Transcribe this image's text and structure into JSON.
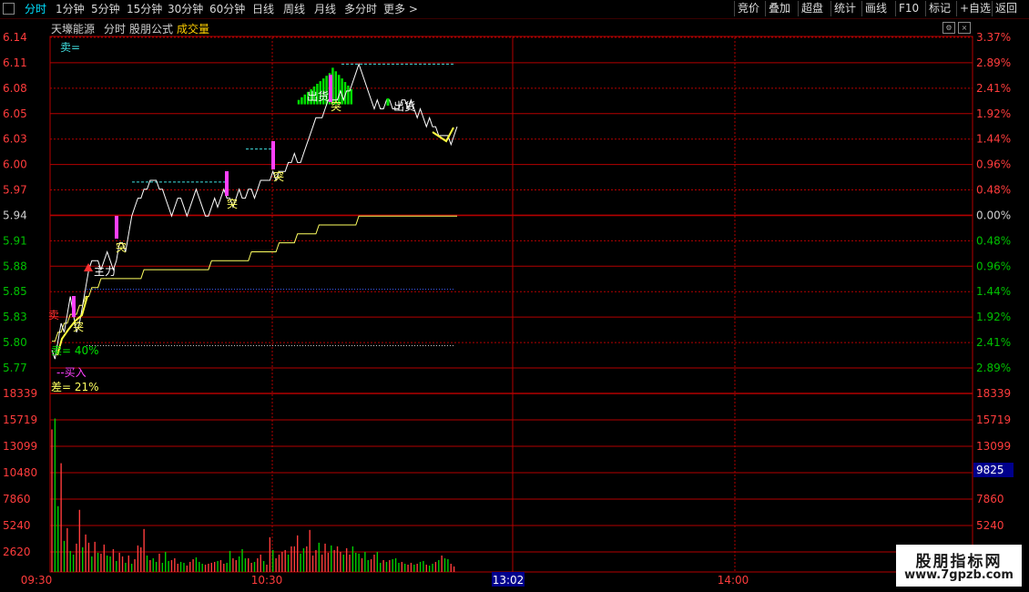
{
  "toolbar": {
    "tabs": [
      "分时",
      "1分钟",
      "5分钟",
      "15分钟",
      "30分钟",
      "60分钟",
      "日线",
      "周线",
      "月线",
      "多分时",
      "更多 >"
    ],
    "active_tab": "分时",
    "right_buttons": [
      "竞价",
      "叠加",
      "超盘",
      "统计",
      "画线",
      "F10",
      "标记",
      "+自选",
      "返回"
    ]
  },
  "header": {
    "stock_name": "天壕能源",
    "mode": "分时",
    "formula": "股朋公式",
    "volume_label": "成交量"
  },
  "chart_data": {
    "type": "line",
    "price_axis": {
      "labels": [
        "6.14",
        "6.11",
        "6.08",
        "6.05",
        "6.03",
        "6.00",
        "5.97",
        "5.94",
        "5.91",
        "5.88",
        "5.85",
        "5.83",
        "5.80",
        "5.77"
      ],
      "min": 5.77,
      "max": 6.14,
      "prev_close": 5.94,
      "pct_labels": [
        "3.37%",
        "2.89%",
        "2.41%",
        "1.92%",
        "1.44%",
        "0.96%",
        "0.48%",
        "0.00%",
        "0.48%",
        "0.96%",
        "1.44%",
        "1.92%",
        "2.41%",
        "2.89%"
      ]
    },
    "volume_axis": {
      "labels": [
        "18339",
        "15719",
        "13099",
        "10480",
        "7860",
        "5240",
        "2620"
      ],
      "max": 18339,
      "current_volume": "9825"
    },
    "time_axis": [
      "09:30",
      "10:30",
      "13:02",
      "14:00"
    ],
    "price_series": [
      5.79,
      5.78,
      5.8,
      5.82,
      5.81,
      5.83,
      5.85,
      5.83,
      5.81,
      5.82,
      5.84,
      5.86,
      5.88,
      5.89,
      5.89,
      5.89,
      5.88,
      5.89,
      5.9,
      5.89,
      5.88,
      5.89,
      5.91,
      5.91,
      5.9,
      5.92,
      5.94,
      5.95,
      5.96,
      5.96,
      5.97,
      5.97,
      5.98,
      5.98,
      5.98,
      5.97,
      5.97,
      5.96,
      5.95,
      5.94,
      5.95,
      5.96,
      5.96,
      5.95,
      5.94,
      5.95,
      5.96,
      5.97,
      5.96,
      5.95,
      5.94,
      5.94,
      5.95,
      5.96,
      5.95,
      5.96,
      5.97,
      5.96,
      5.96,
      5.95,
      5.96,
      5.97,
      5.96,
      5.96,
      5.97,
      5.97,
      5.96,
      5.97,
      5.98,
      5.98,
      5.98,
      5.98,
      5.99,
      5.98,
      5.99,
      5.99,
      5.99,
      6.0,
      6.0,
      6.01,
      6.0,
      6.0,
      6.01,
      6.02,
      6.03,
      6.04,
      6.05,
      6.05,
      6.05,
      6.06,
      6.07,
      6.07,
      6.07,
      6.07,
      6.08,
      6.07,
      6.08,
      6.08,
      6.09,
      6.1,
      6.11,
      6.1,
      6.09,
      6.08,
      6.07,
      6.06,
      6.07,
      6.06,
      6.06,
      6.07,
      6.07,
      6.06,
      6.06,
      6.06,
      6.07,
      6.07,
      6.06,
      6.07,
      6.06,
      6.05,
      6.06,
      6.05,
      6.04,
      6.05,
      6.04,
      6.04,
      6.03,
      6.03,
      6.03,
      6.03,
      6.02,
      6.03,
      6.04
    ],
    "avg_series": [
      5.8,
      5.8,
      5.81,
      5.81,
      5.82,
      5.82,
      5.83,
      5.83,
      5.83,
      5.84,
      5.84,
      5.85,
      5.85,
      5.86,
      5.86,
      5.86,
      5.87,
      5.87,
      5.87,
      5.87,
      5.87,
      5.87,
      5.87,
      5.87,
      5.87,
      5.87,
      5.87,
      5.87,
      5.87,
      5.87,
      5.88,
      5.88,
      5.88,
      5.88,
      5.88,
      5.88,
      5.88,
      5.88,
      5.88,
      5.88,
      5.88,
      5.88,
      5.88,
      5.88,
      5.88,
      5.88,
      5.88,
      5.88,
      5.88,
      5.88,
      5.88,
      5.88,
      5.89,
      5.89,
      5.89,
      5.89,
      5.89,
      5.89,
      5.89,
      5.89,
      5.89,
      5.89,
      5.89,
      5.89,
      5.89,
      5.9,
      5.9,
      5.9,
      5.9,
      5.9,
      5.9,
      5.9,
      5.9,
      5.9,
      5.91,
      5.91,
      5.91,
      5.91,
      5.91,
      5.91,
      5.92,
      5.92,
      5.92,
      5.92,
      5.92,
      5.92,
      5.92,
      5.93,
      5.93,
      5.93,
      5.93,
      5.93,
      5.93,
      5.93,
      5.93,
      5.93,
      5.93,
      5.93,
      5.93,
      5.93,
      5.94,
      5.94,
      5.94,
      5.94,
      5.94,
      5.94,
      5.94,
      5.94,
      5.94,
      5.94,
      5.94,
      5.94,
      5.94,
      5.94,
      5.94,
      5.94,
      5.94,
      5.94,
      5.94,
      5.94,
      5.94,
      5.94,
      5.94,
      5.94,
      5.94,
      5.94,
      5.94,
      5.94,
      5.94,
      5.94,
      5.94,
      5.94,
      5.94
    ],
    "volume_series": [
      15600,
      16800,
      7200,
      11900,
      3400,
      4800,
      2300,
      1900,
      3100,
      6800,
      2700,
      4100,
      3200,
      1700,
      3300,
      2100,
      2000,
      3000,
      1800,
      1700,
      2500,
      1200,
      2100,
      1700,
      1000,
      1800,
      900,
      1400,
      2900,
      2700,
      4700,
      1800,
      1300,
      1500,
      1100,
      2000,
      1000,
      2200,
      1200,
      1300,
      1500,
      900,
      1100,
      1000,
      700,
      1100,
      1400,
      1600,
      1100,
      900,
      800,
      900,
      1000,
      1100,
      1200,
      1300,
      900,
      1000,
      2300,
      1500,
      1300,
      1700,
      2500,
      1500,
      1500,
      1000,
      1100,
      1500,
      1900,
      1200,
      800,
      3800,
      2400,
      1500,
      1900,
      2200,
      2400,
      1900,
      2800,
      2800,
      4000,
      2000,
      2600,
      2800,
      4600,
      1800,
      2400,
      3200,
      1900,
      3100,
      2100,
      2900,
      2400,
      2800,
      2200,
      1900,
      2600,
      1900,
      2800,
      2100,
      2000,
      1500,
      2200,
      1300,
      1400,
      1900,
      2200,
      1000,
      1300,
      1100,
      1300,
      1400,
      1500,
      1000,
      1100,
      900,
      800,
      1000,
      800,
      900,
      1100,
      1200,
      800,
      700,
      900,
      1100,
      1300,
      1800,
      1500,
      1400,
      900,
      600
    ],
    "volume_up": [
      true,
      false,
      false,
      true,
      false,
      true,
      false,
      false,
      true,
      true,
      false,
      true,
      true,
      false,
      true,
      false,
      true,
      true,
      false,
      false,
      true,
      false,
      true,
      true,
      false,
      true,
      false,
      true,
      true,
      true,
      true,
      false,
      true,
      false,
      false,
      true,
      false,
      false,
      false,
      true,
      true,
      true,
      false,
      false,
      true,
      true,
      true,
      false,
      false,
      false,
      true,
      true,
      true,
      true,
      false,
      true,
      true,
      false,
      false,
      true,
      true,
      false,
      false,
      false,
      true,
      true,
      false,
      true,
      true,
      false,
      true,
      true,
      false,
      true,
      true,
      true,
      true,
      false,
      true,
      true,
      true,
      false,
      false,
      true,
      true,
      true,
      true,
      false,
      true,
      true,
      true,
      false,
      true,
      true,
      true,
      false,
      true,
      true,
      false,
      false,
      false,
      true,
      false,
      false,
      true,
      true,
      false,
      false,
      true,
      false,
      true,
      false,
      false,
      false,
      true,
      false,
      true,
      true,
      false,
      true,
      false,
      false,
      true,
      false,
      false,
      true,
      false,
      true,
      false,
      false,
      true,
      true
    ],
    "signals": {
      "sell_pct": "卖= 40%",
      "diff_pct": "差= 21%",
      "buy_in": "--买入",
      "main_force": "主力",
      "breakout": "突",
      "sell_out": "出货",
      "sell_eq": "卖=",
      "sell_short": "卖"
    }
  },
  "watermark": {
    "line1": "股朋指标网",
    "line2": "www.7gpzb.com"
  },
  "colors": {
    "up": "#ff3c3c",
    "down": "#00d000",
    "price_line": "#ffffff",
    "avg_line": "#ffff60",
    "grid": "#b40000",
    "magenta": "#ff40ff",
    "cyan": "#40e0e0"
  }
}
